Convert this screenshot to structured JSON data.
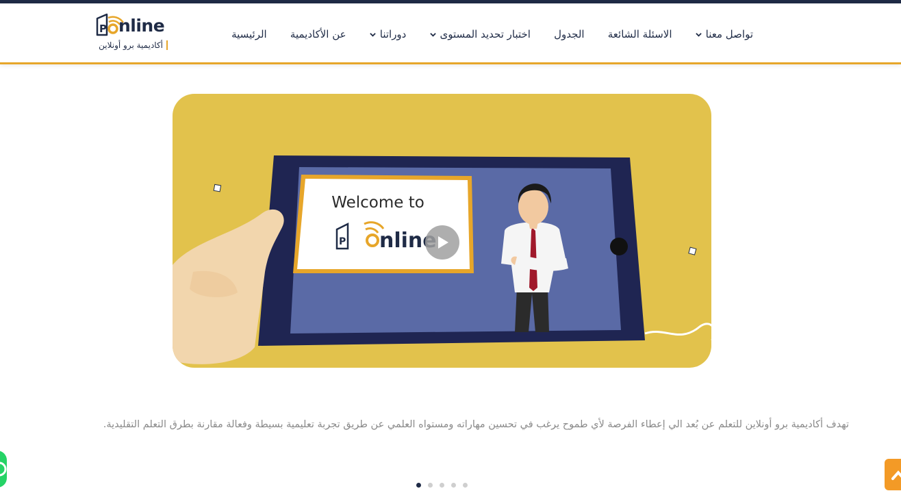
{
  "header": {
    "logo": {
      "word": "nline",
      "subtitle": "أكاديمية برو أونلاين",
      "letter": "P"
    },
    "nav": [
      {
        "label": "الرئيسية",
        "dropdown": false
      },
      {
        "label": "عن الأكاديمية",
        "dropdown": false
      },
      {
        "label": "دوراتنا",
        "dropdown": true
      },
      {
        "label": "اختبار تحديد المستوى",
        "dropdown": true
      },
      {
        "label": "الجدول",
        "dropdown": false
      },
      {
        "label": "الاسئلة الشائعة",
        "dropdown": false
      },
      {
        "label": "تواصل معنا",
        "dropdown": true
      }
    ]
  },
  "video": {
    "screen_title": "Welcome to",
    "screen_logo_word": "nline",
    "screen_logo_letter": "P",
    "play_icon": "play-icon"
  },
  "description": "تهدف أكاديمية برو أونلاين للتعلم عن بُعد الي إعطاء الفرصة لأي طموح يرغب في تحسين مهاراته ومستواه العلمي عن طريق تجربة تعليمية بسيطة وفعالة مقارنة بطرق التعلم التقليدية.",
  "carousel": {
    "count": 5,
    "active": 1
  },
  "floating": {
    "whatsapp_icon": "whatsapp-icon",
    "scroll_top_icon": "arrow-up-icon"
  },
  "colors": {
    "navy": "#1f2b46",
    "accent": "#e7a62a",
    "video_bg": "#e2c24c",
    "tablet": "#1f2552",
    "screen": "#5a6aa6",
    "text_muted": "#8a8a8a"
  }
}
